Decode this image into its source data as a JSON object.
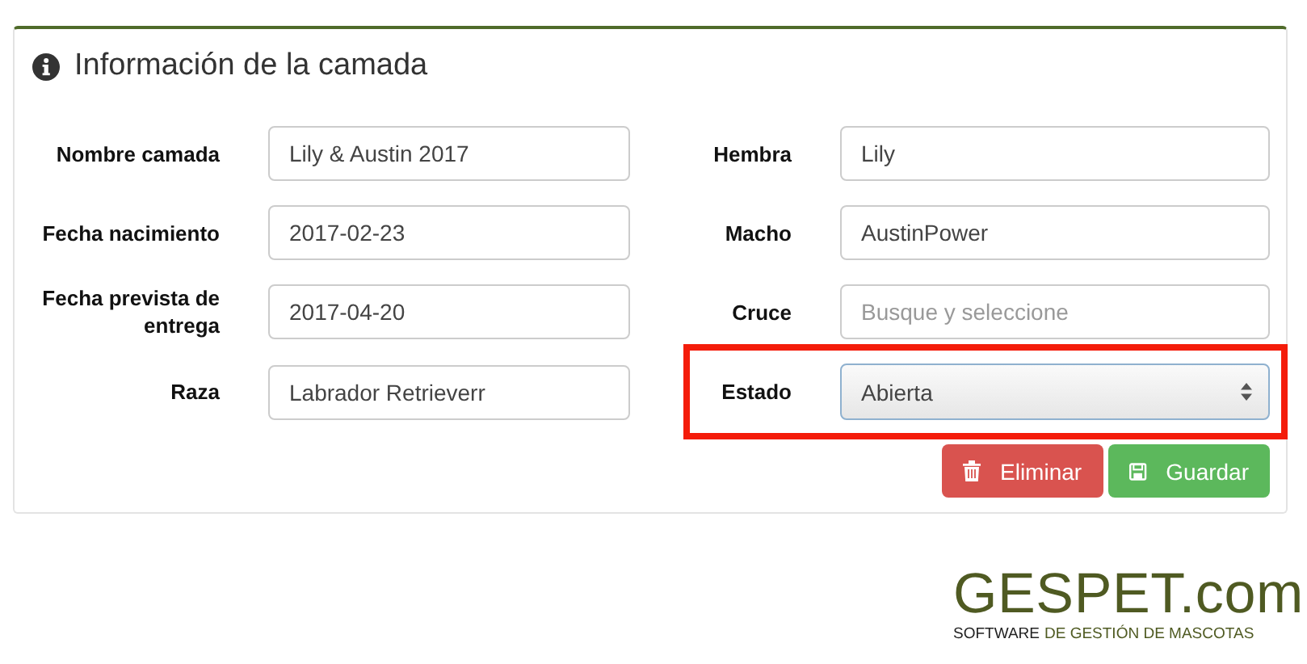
{
  "panel": {
    "title": "Información de la camada"
  },
  "rows": [
    {
      "left": {
        "label": "Nombre camada",
        "kind": "input",
        "value": "Lily & Austin 2017"
      },
      "right": {
        "label": "Hembra",
        "kind": "input",
        "value": "Lily",
        "highlighted": false
      }
    },
    {
      "left": {
        "label": "Fecha nacimiento",
        "kind": "input",
        "value": "2017-02-23"
      },
      "right": {
        "label": "Macho",
        "kind": "input",
        "value": "AustinPower",
        "highlighted": false
      }
    },
    {
      "left": {
        "label": "Fecha prevista de entrega",
        "kind": "input",
        "value": "2017-04-20"
      },
      "right": {
        "label": "Cruce",
        "kind": "input",
        "placeholder": "Busque y seleccione",
        "highlighted": false
      }
    },
    {
      "left": {
        "label": "Raza",
        "kind": "input",
        "value": "Labrador Retrieverr"
      },
      "right": {
        "label": "Estado",
        "kind": "select",
        "value": "Abierta",
        "highlighted": true
      }
    }
  ],
  "buttons": [
    {
      "label": "Eliminar",
      "kind": "delete"
    },
    {
      "label": "Guardar",
      "kind": "save"
    }
  ],
  "logo": {
    "name": "GESPET.com",
    "tagline_start": "SOFTWARE",
    "tagline_end": "DE GESTIÓN DE MASCOTAS"
  }
}
